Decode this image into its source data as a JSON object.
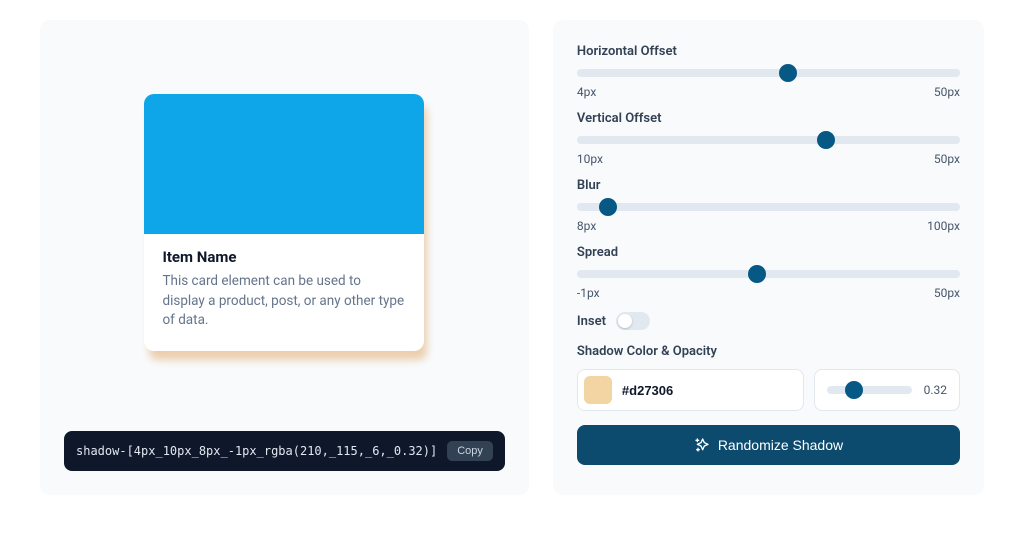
{
  "card": {
    "title": "Item Name",
    "description": "This card element can be used to display a product, post, or any other type of data."
  },
  "code": {
    "value": "shadow-[4px_10px_8px_-1px_rgba(210,_115,_6,_0.32)]",
    "copy_label": "Copy"
  },
  "sliders": {
    "hOffset": {
      "label": "Horizontal Offset",
      "value": "4px",
      "max": "50px",
      "percent": 55
    },
    "vOffset": {
      "label": "Vertical Offset",
      "value": "10px",
      "max": "50px",
      "percent": 65
    },
    "blur": {
      "label": "Blur",
      "value": "8px",
      "max": "100px",
      "percent": 8
    },
    "spread": {
      "label": "Spread",
      "value": "-1px",
      "max": "50px",
      "percent": 47
    }
  },
  "inset": {
    "label": "Inset",
    "on": false
  },
  "color": {
    "label": "Shadow Color & Opacity",
    "hex": "#d27306",
    "swatch": "#f3d4a3",
    "opacity": "0.32",
    "opacity_percent": 32
  },
  "randomize_label": "Randomize Shadow"
}
